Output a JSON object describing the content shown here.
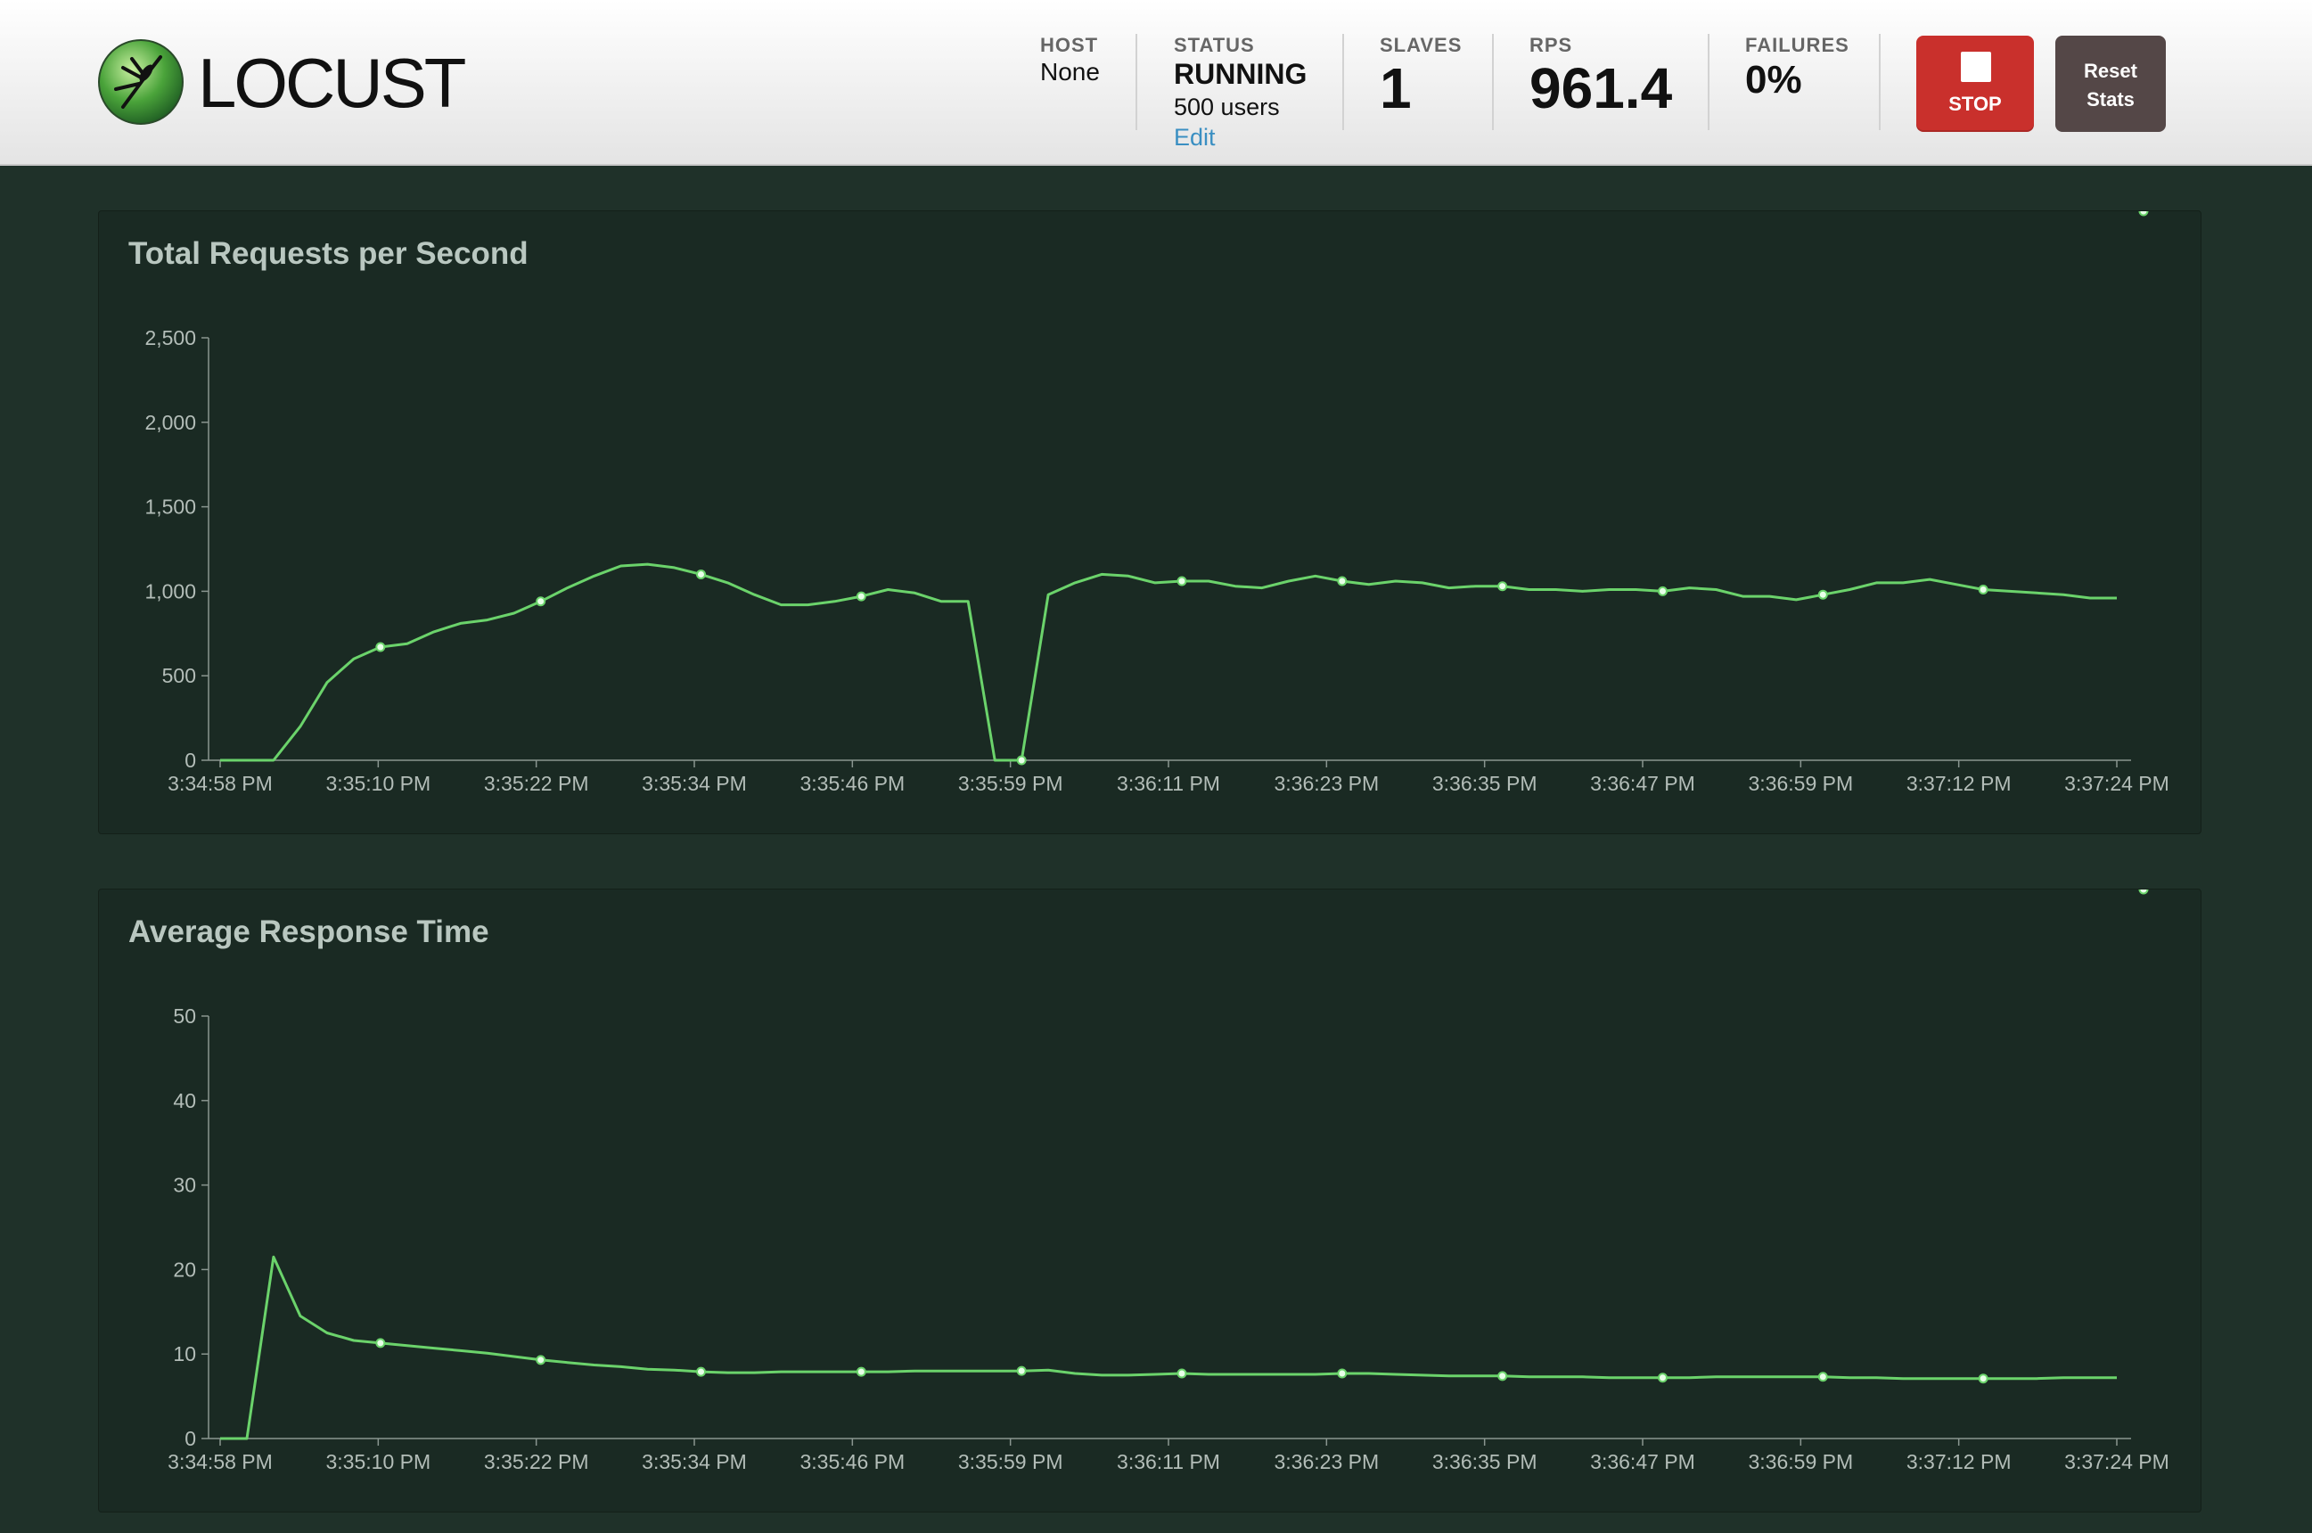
{
  "header": {
    "app_name": "LOCUST",
    "host": {
      "label": "HOST",
      "value": "None"
    },
    "status": {
      "label": "STATUS",
      "value": "RUNNING",
      "users": "500 users",
      "edit_label": "Edit"
    },
    "slaves": {
      "label": "SLAVES",
      "value": "1"
    },
    "rps": {
      "label": "RPS",
      "value": "961.4"
    },
    "failures": {
      "label": "FAILURES",
      "value": "0%"
    },
    "stop_label": "STOP",
    "reset_label_line1": "Reset",
    "reset_label_line2": "Stats"
  },
  "colors": {
    "line": "#6bd36b",
    "panel_bg": "#1a2a23",
    "page_bg": "#1f3129",
    "stop": "#c9302c",
    "reset": "#544747"
  },
  "chart_data": [
    {
      "type": "line",
      "title": "Total Requests per Second",
      "xlabel": "",
      "ylabel": "",
      "ylim": [
        0,
        2500
      ],
      "yticks": [
        0,
        500,
        1000,
        1500,
        2000,
        2500
      ],
      "ytick_labels": [
        "0",
        "500",
        "1,000",
        "1,500",
        "2,000",
        "2,500"
      ],
      "xtick_labels": [
        "3:34:58 PM",
        "3:35:10 PM",
        "3:35:22 PM",
        "3:35:34 PM",
        "3:35:46 PM",
        "3:35:59 PM",
        "3:36:11 PM",
        "3:36:23 PM",
        "3:36:35 PM",
        "3:36:47 PM",
        "3:36:59 PM",
        "3:37:12 PM",
        "3:37:24 PM"
      ],
      "x_range_seconds": [
        0,
        144
      ],
      "grid": false,
      "series": [
        {
          "values": [
            0,
            0,
            0,
            200,
            460,
            600,
            670,
            690,
            760,
            810,
            830,
            870,
            940,
            1020,
            1090,
            1150,
            1160,
            1140,
            1100,
            1050,
            980,
            920,
            920,
            940,
            970,
            1010,
            990,
            940,
            940,
            0,
            0,
            980,
            1050,
            1100,
            1090,
            1050,
            1060,
            1060,
            1030,
            1020,
            1060,
            1090,
            1060,
            1040,
            1060,
            1050,
            1020,
            1030,
            1030,
            1010,
            1010,
            1000,
            1010,
            1010,
            1000,
            1020,
            1010,
            970,
            970,
            950,
            980,
            1010,
            1050,
            1050,
            1070,
            1040,
            1010,
            1000,
            990,
            980,
            960,
            960
          ],
          "marker_indices": [
            6,
            12,
            18,
            24,
            30,
            36,
            42,
            48,
            54,
            60,
            66,
            72
          ]
        }
      ]
    },
    {
      "type": "line",
      "title": "Average Response Time",
      "xlabel": "",
      "ylabel": "",
      "ylim": [
        0,
        50
      ],
      "yticks": [
        0,
        10,
        20,
        30,
        40,
        50
      ],
      "ytick_labels": [
        "0",
        "10",
        "20",
        "30",
        "40",
        "50"
      ],
      "xtick_labels": [
        "3:34:58 PM",
        "3:35:10 PM",
        "3:35:22 PM",
        "3:35:34 PM",
        "3:35:46 PM",
        "3:35:59 PM",
        "3:36:11 PM",
        "3:36:23 PM",
        "3:36:35 PM",
        "3:36:47 PM",
        "3:36:59 PM",
        "3:37:12 PM",
        "3:37:24 PM"
      ],
      "x_range_seconds": [
        0,
        144
      ],
      "grid": false,
      "series": [
        {
          "values": [
            0,
            0,
            21.5,
            14.5,
            12.5,
            11.6,
            11.3,
            11,
            10.7,
            10.4,
            10.1,
            9.7,
            9.3,
            9.0,
            8.7,
            8.5,
            8.2,
            8.1,
            7.9,
            7.8,
            7.8,
            7.9,
            7.9,
            7.9,
            7.9,
            7.9,
            8.0,
            8.0,
            8.0,
            8.0,
            8.0,
            8.1,
            7.7,
            7.5,
            7.5,
            7.6,
            7.7,
            7.6,
            7.6,
            7.6,
            7.6,
            7.6,
            7.7,
            7.7,
            7.6,
            7.5,
            7.4,
            7.4,
            7.4,
            7.3,
            7.3,
            7.3,
            7.2,
            7.2,
            7.2,
            7.2,
            7.3,
            7.3,
            7.3,
            7.3,
            7.3,
            7.2,
            7.2,
            7.1,
            7.1,
            7.1,
            7.1,
            7.1,
            7.1,
            7.2,
            7.2,
            7.2
          ],
          "marker_indices": [
            6,
            12,
            18,
            24,
            30,
            36,
            42,
            48,
            54,
            60,
            66,
            72
          ]
        }
      ]
    }
  ]
}
